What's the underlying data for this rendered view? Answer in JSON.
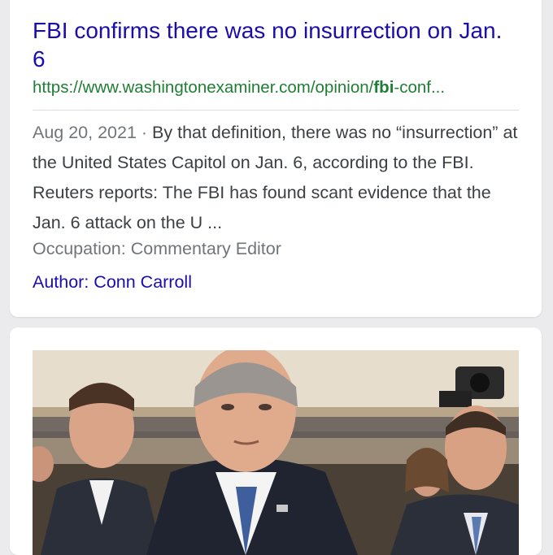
{
  "result": {
    "title": "FBI confirms there was no insurrection on Jan. 6",
    "url_prefix": "https://www.washingtonexaminer.com/opinion/",
    "url_bold": "fbi",
    "url_suffix": "-conf...",
    "date": "Aug 20, 2021",
    "separator": " · ",
    "snippet": "By that definition, there was no “insurrection” at the United States Capitol on Jan. 6, according to the FBI. Reuters reports: The FBI has found scant evidence that the Jan. 6 attack on the U ...",
    "occupation": "Occupation: Commentary Editor",
    "author": "Author: Conn Carroll"
  },
  "colors": {
    "title_link": "#1a0dab",
    "url_green": "#1e7e34",
    "snippet_text": "#3c4043",
    "meta_gray": "#70757a"
  }
}
